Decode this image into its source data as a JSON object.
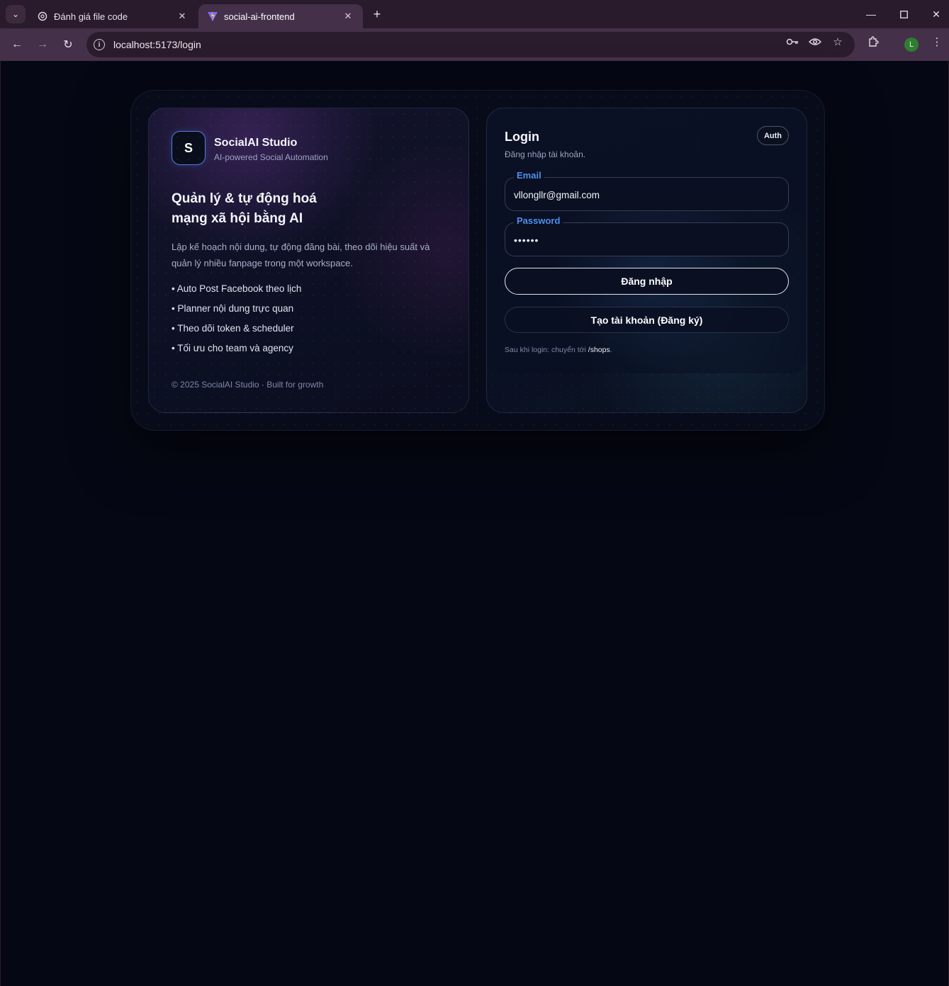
{
  "browser": {
    "tabs": [
      {
        "label": "Đánh giá file code",
        "icon": "openai-icon",
        "active": false
      },
      {
        "label": "social-ai-frontend",
        "icon": "vite-icon",
        "active": true
      }
    ],
    "url": "localhost:5173/login",
    "profile_initial": "L"
  },
  "brand": {
    "logo_letter": "S",
    "name": "SocialAI Studio",
    "tagline": "AI-powered Social Automation"
  },
  "hero": {
    "title_line1": "Quản lý & tự động hoá",
    "title_line2": "mạng xã hội bằng AI",
    "description": "Lập kế hoạch nội dung, tự động đăng bài, theo dõi hiệu suất và quản lý nhiều fanpage trong một workspace.",
    "features": [
      "• Auto Post Facebook theo lịch",
      "• Planner nội dung trực quan",
      "• Theo dõi token & scheduler",
      "• Tối ưu cho team và agency"
    ],
    "footer": "© 2025 SocialAI Studio · Built for growth"
  },
  "login": {
    "title": "Login",
    "subtitle": "Đăng nhập tài khoản.",
    "badge": "Auth",
    "email_label": "Email",
    "email_value": "vllongllr@gmail.com",
    "password_label": "Password",
    "password_value": "••••••",
    "submit_label": "Đăng nhập",
    "register_label": "Tạo tài khoản (Đăng ký)",
    "redirect_prefix": "Sau khi login: chuyển tới",
    "redirect_path": "/shops",
    "redirect_suffix": "."
  }
}
